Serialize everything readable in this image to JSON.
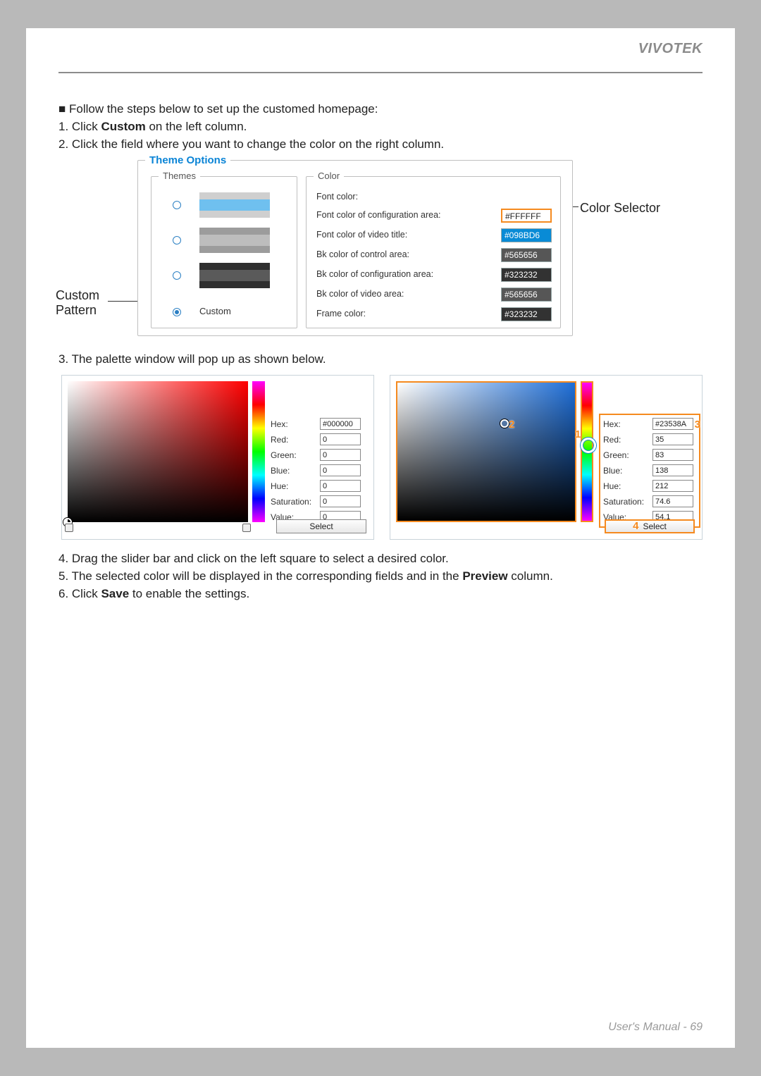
{
  "header": {
    "brand": "VIVOTEK"
  },
  "intro": {
    "bullet": "■ Follow the steps below to set up the customed homepage:",
    "step1_pre": "1. Click ",
    "step1_bold": "Custom",
    "step1_post": " on the left column.",
    "step2": "2. Click the field where you want to change the color on the right column."
  },
  "themeOptions": {
    "title": "Theme Options",
    "themesTitle": "Themes",
    "colorTitle": "Color",
    "customLabel": "Custom",
    "colorRows": [
      {
        "label": "Font color:",
        "value": "",
        "bg": "#ffffff",
        "textLight": true
      },
      {
        "label": "Font color of configuration area:",
        "value": "#FFFFFF",
        "bg": "#ffffff",
        "textLight": true,
        "selected": true
      },
      {
        "label": "Font color of video title:",
        "value": "#098BD6",
        "bg": "#098BD6"
      },
      {
        "label": "Bk color of control area:",
        "value": "#565656",
        "bg": "#565656"
      },
      {
        "label": "Bk color of configuration area:",
        "value": "#323232",
        "bg": "#323232"
      },
      {
        "label": "Bk color of video area:",
        "value": "#565656",
        "bg": "#565656"
      },
      {
        "label": "Frame color:",
        "value": "#323232",
        "bg": "#323232"
      }
    ]
  },
  "callouts": {
    "customPattern": "Custom\nPattern",
    "colorSelector": "Color Selector"
  },
  "step3": "3. The palette window will pop up as shown below.",
  "palette1": {
    "hue": "#ff0000",
    "fields": {
      "Hex": "#000000",
      "Red": "0",
      "Green": "0",
      "Blue": "0",
      "Hue": "0",
      "Saturation": "0",
      "Value": "0"
    },
    "selectLabel": "Select"
  },
  "palette2": {
    "hue": "#1f6fd8",
    "fields": {
      "Hex": "#23538A",
      "Red": "35",
      "Green": "83",
      "Blue": "138",
      "Hue": "212",
      "Saturation": "74.6",
      "Value": "54.1"
    },
    "selectLabel": "Select",
    "badges": {
      "hueBar": "1",
      "svArea": "2",
      "valueCol": "3",
      "selectBtn": "4"
    }
  },
  "afterSteps": {
    "s4": "4. Drag the slider bar and click on the left square to select a desired color.",
    "s5_pre": "5. The selected color will be displayed in the corresponding fields and in the ",
    "s5_bold": "Preview",
    "s5_post": " column.",
    "s6_pre": "6. Click ",
    "s6_bold": "Save",
    "s6_post": " to enable the settings."
  },
  "footer": {
    "text": "User's Manual - ",
    "page": "69"
  },
  "fieldOrder": [
    "Hex",
    "Red",
    "Green",
    "Blue",
    "Hue",
    "Saturation",
    "Value"
  ]
}
